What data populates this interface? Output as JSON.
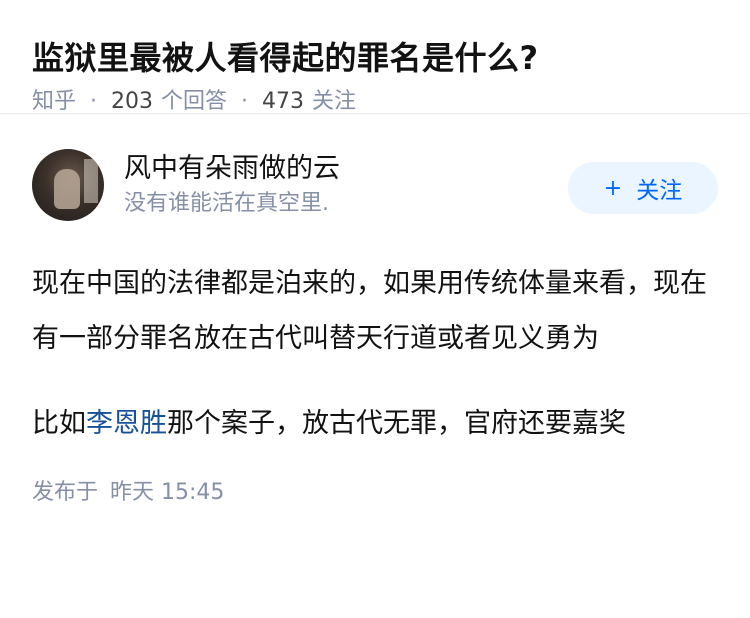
{
  "question": {
    "title": "监狱里最被人看得起的罪名是什么?",
    "source": "知乎",
    "answer_count": "203",
    "answer_label": "个回答",
    "follow_count": "473",
    "follow_label": "关注"
  },
  "answer": {
    "author_name": "风中有朵雨做的云",
    "author_bio": "没有谁能活在真空里.",
    "follow_button": {
      "icon": "+",
      "label": "关注"
    },
    "paragraph1": "现在中国的法律都是泊来的，如果用传统体量来看，现在有一部分罪名放在古代叫替天行道或者见义勇为",
    "paragraph2_before": "比如",
    "paragraph2_link": "李恩胜",
    "paragraph2_after": "那个案子，放古代无罪，官府还要嘉奖",
    "published_label": "发布于",
    "published_time": "昨天 15:45"
  },
  "colors": {
    "accent": "#0066ff",
    "link": "#175199",
    "meta": "#8590a6",
    "follow_bg": "#ebf5ff"
  }
}
